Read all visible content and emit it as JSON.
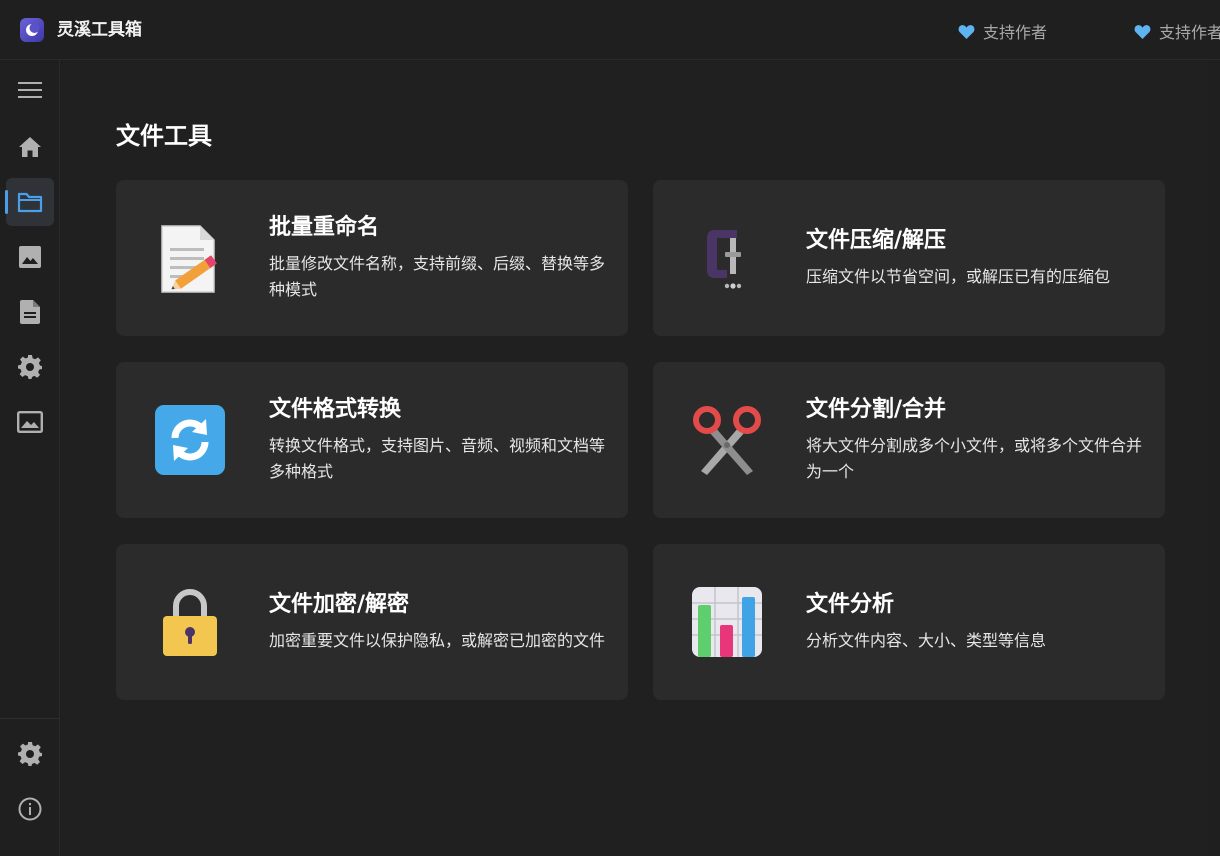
{
  "app": {
    "title": "灵溪工具箱"
  },
  "header": {
    "support_1": "支持作者",
    "support_2": "支持作者"
  },
  "main": {
    "title": "文件工具",
    "cards": [
      {
        "title": "批量重命名",
        "desc": "批量修改文件名称，支持前缀、后缀、替换等多种模式",
        "icon": "memo-pencil-icon"
      },
      {
        "title": "文件压缩/解压",
        "desc": "压缩文件以节省空间，或解压已有的压缩包",
        "icon": "clamp-icon"
      },
      {
        "title": "文件格式转换",
        "desc": "转换文件格式，支持图片、音频、视频和文档等多种格式",
        "icon": "refresh-arrows-icon"
      },
      {
        "title": "文件分割/合并",
        "desc": "将大文件分割成多个小文件，或将多个文件合并为一个",
        "icon": "scissors-icon"
      },
      {
        "title": "文件加密/解密",
        "desc": "加密重要文件以保护隐私，或解密已加密的文件",
        "icon": "padlock-icon"
      },
      {
        "title": "文件分析",
        "desc": "分析文件内容、大小、类型等信息",
        "icon": "bar-chart-icon"
      }
    ]
  },
  "colors": {
    "accent": "#4a9eea",
    "card_bg": "#2b2b2b",
    "window_bg": "#1f1f1f",
    "heart": "#5fb3f0"
  }
}
